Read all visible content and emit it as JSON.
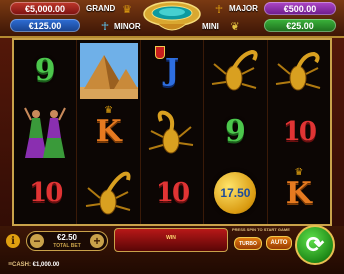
{
  "jackpots": {
    "grand": {
      "label": "GRAND",
      "value": "€5,000.00"
    },
    "major": {
      "label": "MAJOR",
      "value": "€500.00"
    },
    "minor": {
      "label": "MINOR",
      "value": "€125.00"
    },
    "mini": {
      "label": "MINI",
      "value": "€25.00"
    }
  },
  "reels": [
    [
      {
        "symbol": "9",
        "icon": ""
      },
      {
        "symbol": "",
        "icon": "dancers-icon"
      },
      {
        "symbol": "10",
        "icon": ""
      }
    ],
    [
      {
        "symbol": "",
        "icon": "pyramids-icon"
      },
      {
        "symbol": "K",
        "icon": "crown-icon"
      },
      {
        "symbol": "",
        "icon": "scorpion-icon"
      }
    ],
    [
      {
        "symbol": "J",
        "icon": "shield-icon"
      },
      {
        "symbol": "",
        "icon": "scorpion-icon"
      },
      {
        "symbol": "10",
        "icon": ""
      }
    ],
    [
      {
        "symbol": "",
        "icon": "scorpion-icon"
      },
      {
        "symbol": "9",
        "icon": ""
      },
      {
        "symbol": "17.50",
        "icon": "coin-icon"
      }
    ],
    [
      {
        "symbol": "",
        "icon": "scorpion-icon"
      },
      {
        "symbol": "10",
        "icon": ""
      },
      {
        "symbol": "K",
        "icon": "crown-icon"
      }
    ]
  ],
  "controls": {
    "info_label": "i",
    "minus_label": "−",
    "plus_label": "+",
    "bet_value": "€2.50",
    "bet_label": "TOTAL BET",
    "win_label": "WIN",
    "hint": "PRESS SPIN TO START GAME",
    "turbo_label": "TURBO",
    "auto_label": "AUTO",
    "spin_symbol": "⟳",
    "menu_label": "≡",
    "cash_label": "CASH:",
    "cash_value": "€1,000.00"
  },
  "colors": {
    "grand": "#c0392b",
    "major": "#b048c8",
    "minor": "#2f6fd8",
    "mini": "#3bb53b",
    "gold": "#c9a24a"
  }
}
